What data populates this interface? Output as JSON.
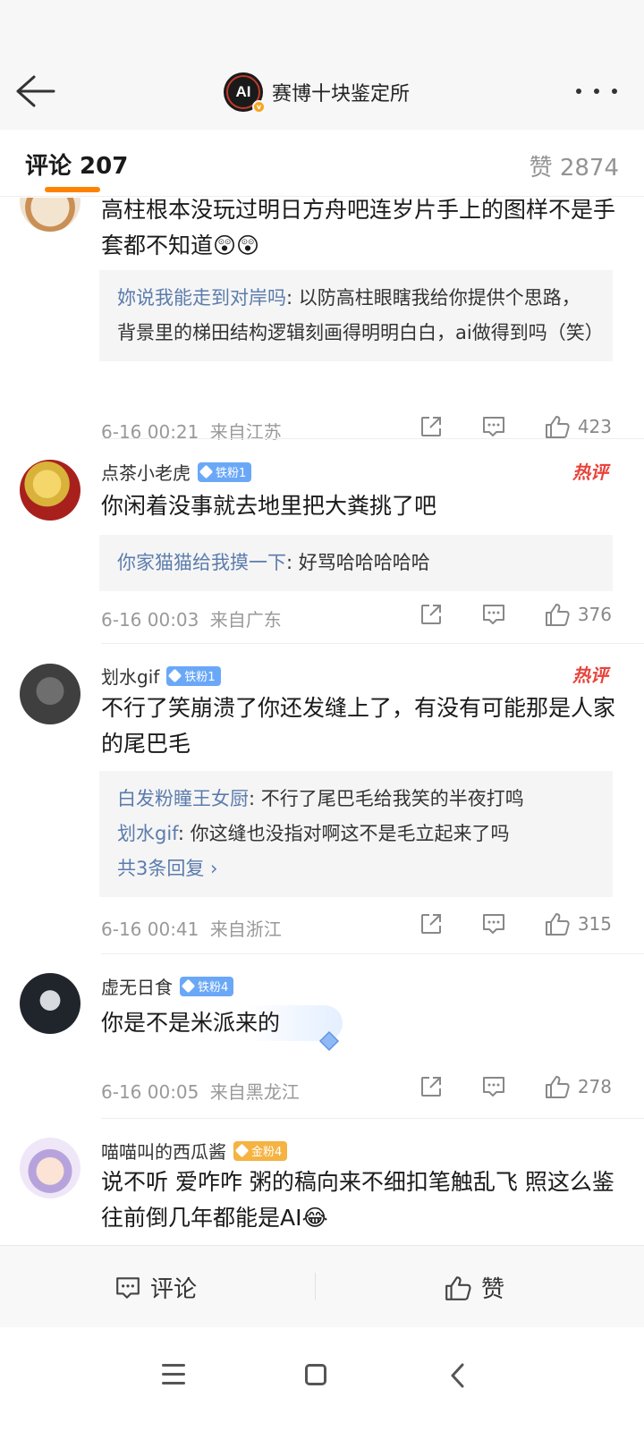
{
  "header": {
    "account_name": "赛博十块鉴定所",
    "logo_text": "AI",
    "verified_badge": "v"
  },
  "tabs": {
    "comments_label": "评论 207",
    "likes_label": "赞 2874"
  },
  "comments": [
    {
      "text": "高柱根本没玩过明日方舟吧连岁片手上的图样不是手套都不知道😲😲",
      "replies": [
        {
          "name": "妳说我能走到对岸吗",
          "text": ": 以防高柱眼瞎我给你提供个思路，背景里的梯田结构逻辑刻画得明明白白，ai做得到吗（笑）"
        }
      ],
      "time": "6-16 00:21",
      "location": "来自江苏",
      "likes": "423"
    },
    {
      "username": "点茶小老虎",
      "badge": "铁粉1",
      "hot": "热评",
      "text": "你闲着没事就去地里把大粪挑了吧",
      "replies": [
        {
          "name": "你家猫猫给我摸一下",
          "text": ": 好骂哈哈哈哈哈"
        }
      ],
      "time": "6-16 00:03",
      "location": "来自广东",
      "likes": "376"
    },
    {
      "username": "划水gif",
      "badge": "铁粉1",
      "hot": "热评",
      "text": "不行了笑崩溃了你还发缝上了，有没有可能那是人家的尾巴毛",
      "replies": [
        {
          "name": "白发粉瞳王女厨",
          "text": ": 不行了尾巴毛给我笑的半夜打鸣"
        },
        {
          "name": "划水gif",
          "text": ": 你这缝也没指对啊这不是毛立起来了吗"
        }
      ],
      "more_replies": "共3条回复 ›",
      "time": "6-16 00:41",
      "location": "来自浙江",
      "likes": "315"
    },
    {
      "username": "虚无日食",
      "badge": "铁粉4",
      "text": "你是不是米派来的",
      "time": "6-16 00:05",
      "location": "来自黑龙江",
      "likes": "278"
    },
    {
      "username": "喵喵叫的西瓜酱",
      "badge": "金粉4",
      "text": "说不听 爱咋咋 粥的稿向来不细扣笔触乱飞 照这么鉴往前倒几年都能是AI😂"
    }
  ],
  "bottom_bar": {
    "comment_label": "评论",
    "like_label": "赞"
  },
  "colors": {
    "accent": "#ff8200",
    "link": "#5b7cad",
    "hot": "#e8433a",
    "fan_badge": "#6aa8f7",
    "gold_badge": "#f5b342"
  }
}
